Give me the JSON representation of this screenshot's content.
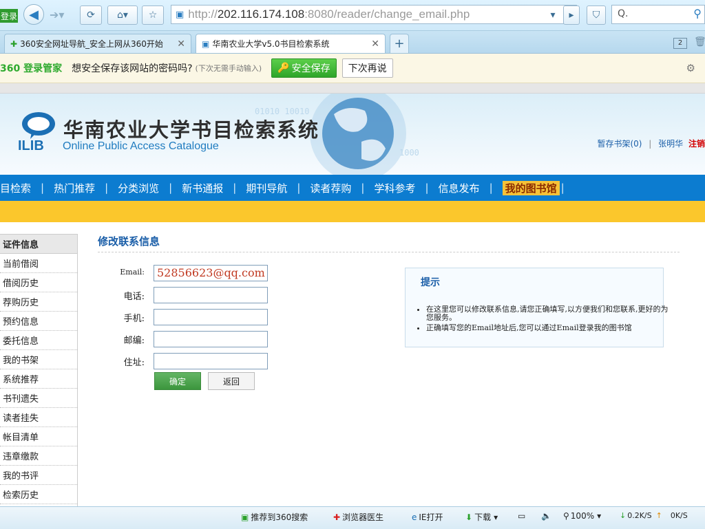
{
  "browser": {
    "login_badge": "登录",
    "url_prefix": "http://",
    "url_host": "202.116.174.108",
    "url_rest": ":8080/reader/change_email.php",
    "search_placeholder": "Q.",
    "tabs": [
      {
        "label": "360安全网址导航_安全上网从360开始"
      },
      {
        "label": "华南农业大学v5.0书目检索系统"
      }
    ],
    "new_tab": "+",
    "tab_count": "2"
  },
  "password_bar": {
    "brand": "360 登录管家",
    "message": "想安全保存该网站的密码吗?",
    "hint": "(下次无需手动输入)",
    "save_label": "安全保存",
    "later_label": "下次再说"
  },
  "site": {
    "logo_mark": "ILIB",
    "title": "华南农业大学书目检索系统",
    "subtitle": "Online Public Access Catalogue",
    "shelf_link": "暂存书架(0)",
    "separator": "|",
    "user_name": "张明华",
    "logout": "注销",
    "nav": [
      "目检索",
      "热门推荐",
      "分类浏览",
      "新书通报",
      "期刊导航",
      "读者荐购",
      "学科参考",
      "信息发布"
    ],
    "nav_active": "我的图书馆"
  },
  "sidebar": {
    "items": [
      "证件信息",
      "当前借阅",
      "借阅历史",
      "荐购历史",
      "预约信息",
      "委托信息",
      "我的书架",
      "系统推荐",
      "书刊遗失",
      "读者挂失",
      "帐目清单",
      "违章缴款",
      "我的书评",
      "检索历史"
    ]
  },
  "form": {
    "title": "修改联系信息",
    "fields": [
      {
        "label": "Email:",
        "value": "52856623@qq.com"
      },
      {
        "label": "电话:",
        "value": ""
      },
      {
        "label": "手机:",
        "value": ""
      },
      {
        "label": "邮编:",
        "value": ""
      },
      {
        "label": "住址:",
        "value": ""
      }
    ],
    "confirm": "确定",
    "back": "返回"
  },
  "tips": {
    "title": "提示",
    "items": [
      "在这里您可以修改联系信息,请您正确填写,以方便我们和您联系,更好的为您服务。",
      "正确填写您的Email地址后,您可以通过Email登录我的图书馆"
    ]
  },
  "status_bar": {
    "recommend": "推荐到360搜索",
    "doctor": "浏览器医生",
    "ie_open": "IE打开",
    "download": "下载",
    "zoom": "100%",
    "down_speed": "0.2K/S",
    "up_speed": "0K/S"
  },
  "colors": {
    "nav_blue": "#0c7cd0",
    "yellow_band": "#fbc72c",
    "link_blue": "#1a5ea8",
    "confirm_green": "#3c963d"
  }
}
